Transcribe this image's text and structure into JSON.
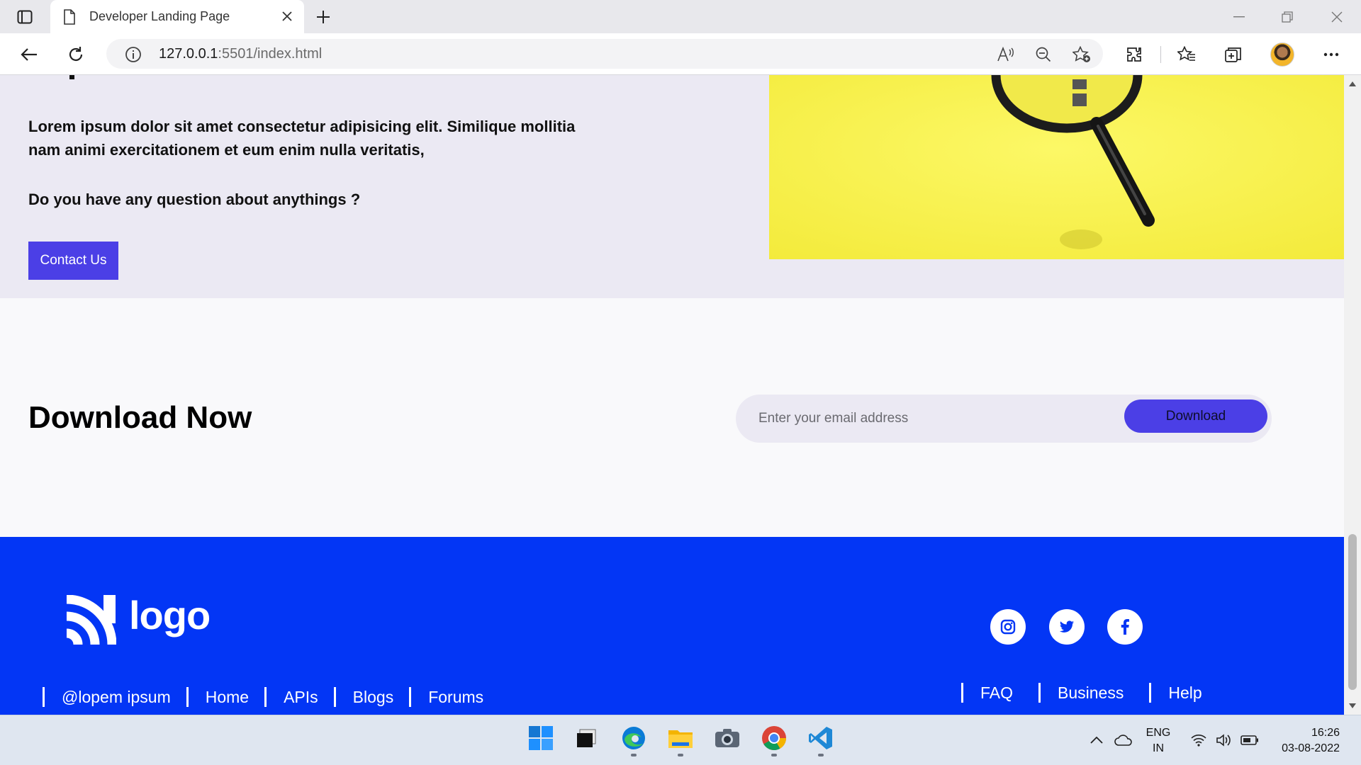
{
  "browser": {
    "tab_title": "Developer Landing Page",
    "url_host": "127.0.0.1",
    "url_rest": ":5501/index.html"
  },
  "page": {
    "intro_text": "Lorem ipsum dolor sit amet consectetur adipisicing elit. Similique mollitia nam animi exercitationem et eum enim nulla veritatis,",
    "question": "Do you have any question about anythings ?",
    "contact_button": "Contact Us",
    "download_title_bold": "Download",
    "download_title_rest": " Now",
    "email_placeholder": "Enter your email address",
    "download_button": "Download",
    "accent_color": "#4b3fe6",
    "footer_color": "#0336f5",
    "image_color": "#f8f04a"
  },
  "footer": {
    "logo_text": "logo",
    "social": [
      "instagram-icon",
      "twitter-icon",
      "facebook-icon"
    ],
    "links_left": [
      "@lopem ipsum",
      "Home",
      "APIs",
      "Blogs",
      "Forums"
    ],
    "links_right": [
      "FAQ",
      "Business",
      "Help"
    ]
  },
  "taskbar": {
    "lang_line1": "ENG",
    "lang_line2": "IN",
    "time": "16:26",
    "date": "03-08-2022"
  }
}
